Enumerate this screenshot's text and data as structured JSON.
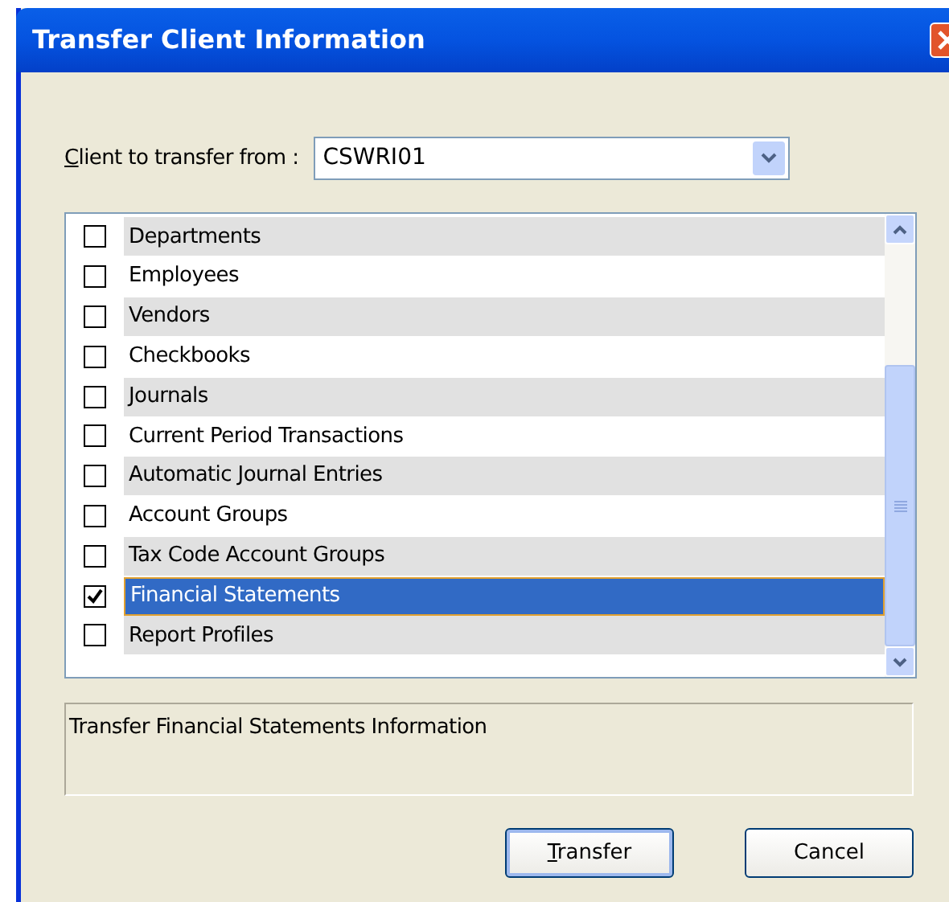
{
  "window": {
    "title": "Transfer Client Information"
  },
  "client_field": {
    "label": "Client to transfer from :",
    "mnemonic_underlined": true,
    "value": "CSWRI01"
  },
  "items": [
    {
      "label": "Departments",
      "checked": false,
      "selected": false
    },
    {
      "label": "Employees",
      "checked": false,
      "selected": false
    },
    {
      "label": "Vendors",
      "checked": false,
      "selected": false
    },
    {
      "label": "Checkbooks",
      "checked": false,
      "selected": false
    },
    {
      "label": "Journals",
      "checked": false,
      "selected": false
    },
    {
      "label": "Current Period Transactions",
      "checked": false,
      "selected": false
    },
    {
      "label": "Automatic Journal Entries",
      "checked": false,
      "selected": false
    },
    {
      "label": "Account Groups",
      "checked": false,
      "selected": false
    },
    {
      "label": "Tax Code Account Groups",
      "checked": false,
      "selected": false
    },
    {
      "label": "Financial Statements",
      "checked": true,
      "selected": true
    },
    {
      "label": "Report Profiles",
      "checked": false,
      "selected": false
    }
  ],
  "description": "Transfer Financial Statements Information",
  "buttons": [
    {
      "label": "Transfer",
      "mnemonic_underlined": true,
      "default": true
    },
    {
      "label": "Cancel",
      "mnemonic_underlined": false,
      "default": false
    }
  ]
}
